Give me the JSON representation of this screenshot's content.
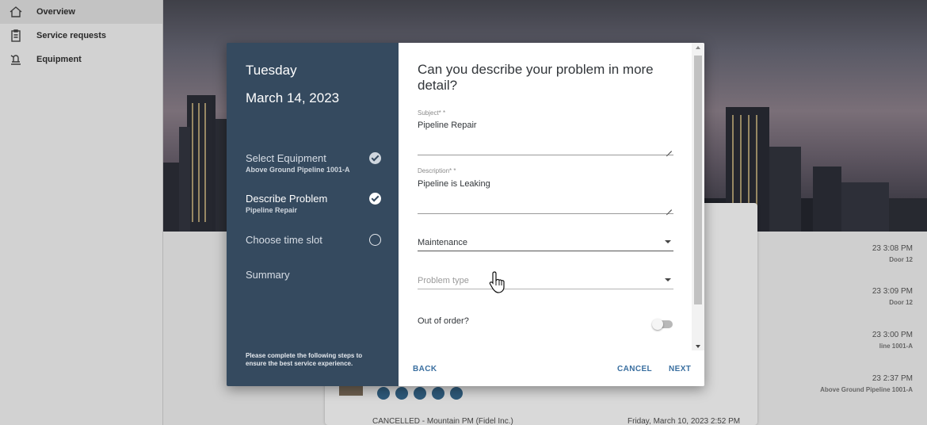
{
  "sidebar": {
    "items": [
      {
        "label": "Overview",
        "icon": "home-icon",
        "active": true
      },
      {
        "label": "Service requests",
        "icon": "clipboard-icon",
        "active": false
      },
      {
        "label": "Equipment",
        "icon": "equipment-icon",
        "active": false
      }
    ]
  },
  "background_list": {
    "rows": [
      {
        "time": "23 3:08 PM",
        "sub": "Door 12"
      },
      {
        "time": "23 3:09 PM",
        "sub": "Door 12"
      },
      {
        "time": "23 3:00 PM",
        "sub": "line 1001-A"
      },
      {
        "time": "23 2:37 PM",
        "sub": "Above Ground Pipeline 1001-A"
      }
    ],
    "bottom_left": "CANCELLED - Mountain PM (Fidel Inc.)",
    "bottom_right": "Friday, March 10, 2023 2:52 PM"
  },
  "wizard": {
    "day": "Tuesday",
    "date": "March 14, 2023",
    "steps": [
      {
        "title": "Select Equipment",
        "subtitle": "Above Ground Pipeline 1001-A",
        "status": "done"
      },
      {
        "title": "Describe Problem",
        "subtitle": "Pipeline Repair",
        "status": "done"
      },
      {
        "title": "Choose time slot",
        "subtitle": "",
        "status": "pending"
      },
      {
        "title": "Summary",
        "subtitle": "",
        "status": "none"
      }
    ],
    "footnote": "Please complete the following steps to ensure the best service experience.",
    "heading": "Can you describe your problem in more detail?",
    "subject_label": "Subject* *",
    "subject_value": "Pipeline Repair",
    "description_label": "Description* *",
    "description_value": "Pipeline is Leaking",
    "category_value": "Maintenance",
    "problem_type_placeholder": "Problem type",
    "out_of_order_label": "Out of order?",
    "out_of_order": false,
    "buttons": {
      "back": "BACK",
      "cancel": "CANCEL",
      "next": "NEXT"
    }
  },
  "colors": {
    "wizard_panel": "#354a5f",
    "accent": "#3a6fa0"
  }
}
